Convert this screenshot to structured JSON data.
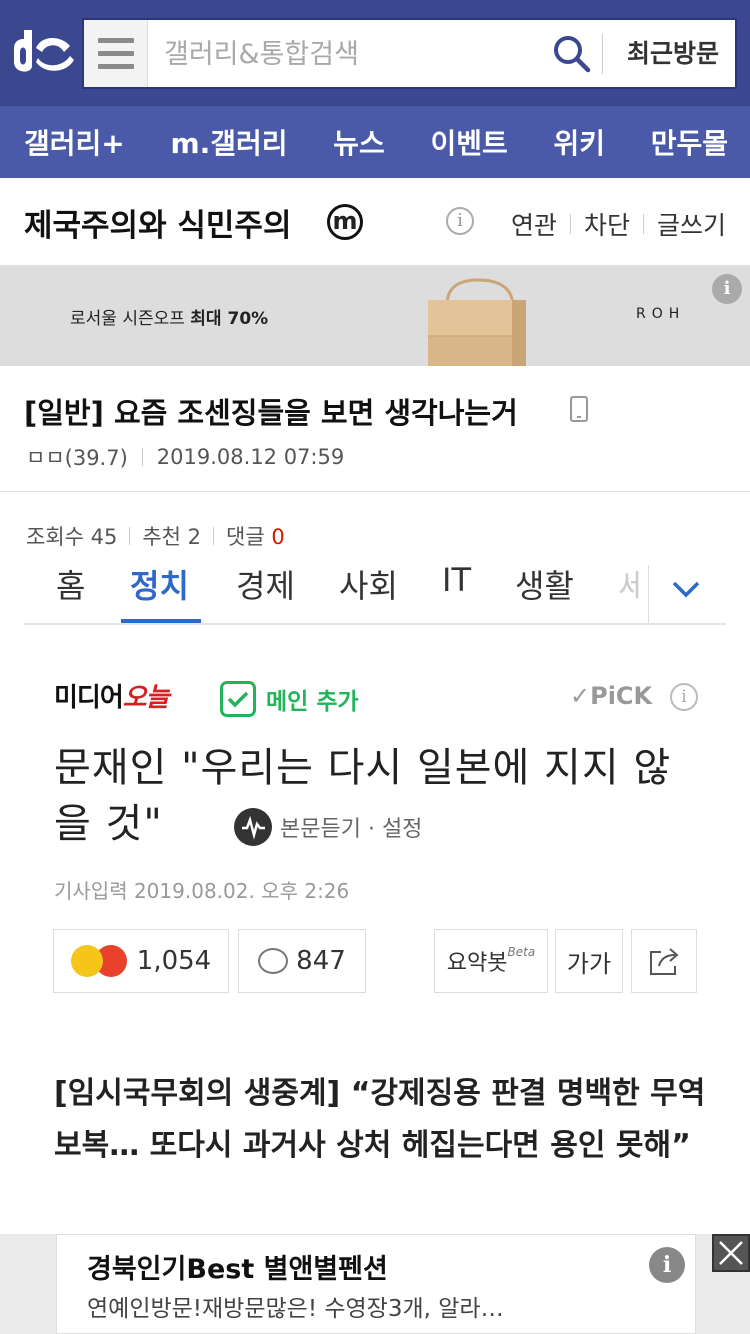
{
  "header": {
    "search_placeholder": "갤러리&통합검색",
    "recent_label": "최근방문",
    "colors": {
      "header_bg": "#3b4890",
      "nav_bg": "#4a5aa9"
    }
  },
  "nav": {
    "items": [
      "갤러리+",
      "m.갤러리",
      "뉴스",
      "이벤트",
      "위키",
      "만두몰"
    ]
  },
  "gallery": {
    "title": "제국주의와 식민주의",
    "badge": "m",
    "info_icon": "i",
    "links": [
      "연관",
      "차단",
      "글쓰기"
    ]
  },
  "ad_banner": {
    "text_prefix": "로서울 시즌오프",
    "text_bold": "최대 70%",
    "brand": "ROH",
    "info": "i"
  },
  "post": {
    "title": "[일반] 요즘 조센징들을 보면 생각나는거",
    "author": "ㅁㅁ(39.7)",
    "date": "2019.08.12 07:59",
    "views_label": "조회수 45",
    "recommend_label": "추천 2",
    "comments_label": "댓글",
    "comments_count": "0"
  },
  "news": {
    "tabs": [
      "홈",
      "정치",
      "경제",
      "사회",
      "IT",
      "생활",
      "세"
    ],
    "active_tab": "정치",
    "press_prefix": "미디어",
    "press_script": "오늘",
    "main_add": "메인 추가",
    "pick": "PiCK",
    "headline": "문재인 \"우리는 다시 일본에 지지 않을 것\"",
    "listen": "본문듣기 · 설정",
    "date": "기사입력  2019.08.02. 오후 2:26",
    "reactions": "1,054",
    "comments": "847",
    "summary_bot": "요약봇",
    "beta": "Beta",
    "font_size_label": "가가",
    "subheading": "[임시국무회의 생중계] “강제징용 판결 명백한 무역보복… 또다시 과거사 상처 헤집는다면 용인 못해”"
  },
  "bottom_ad": {
    "title": "경북인기Best 별앤별펜션",
    "desc": "연예인방문!재방문많은! 수영장3개, 알라…",
    "info": "i"
  }
}
